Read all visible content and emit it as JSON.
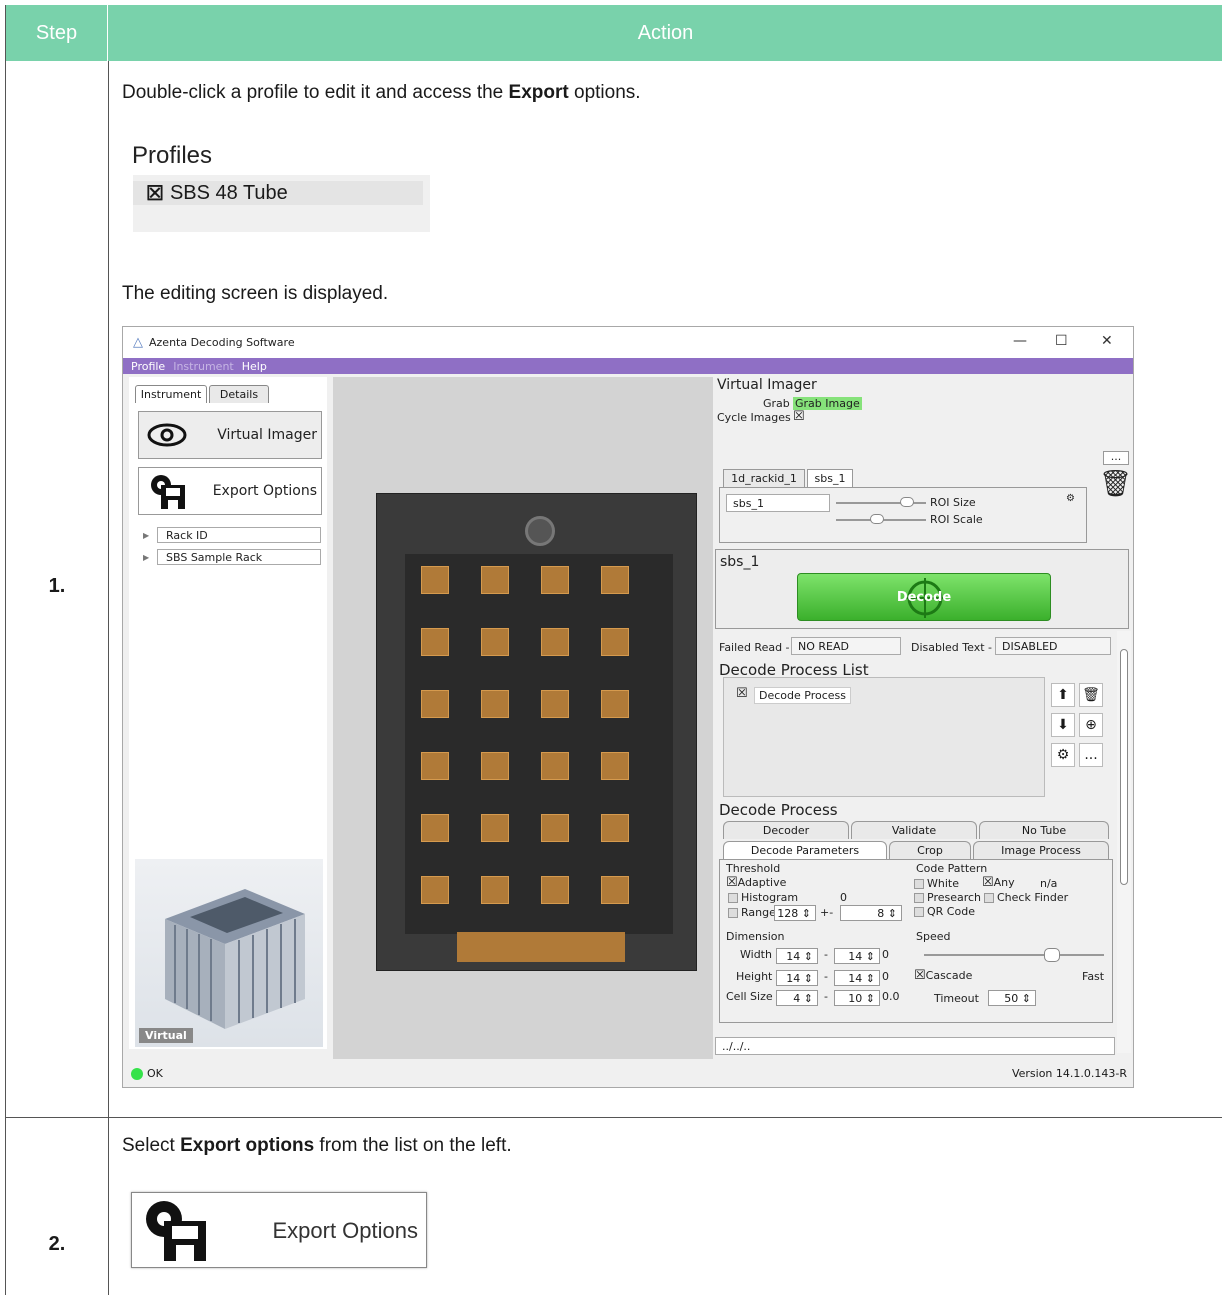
{
  "header": {
    "step": "Step",
    "action": "Action"
  },
  "steps": [
    {
      "num": "1.",
      "intro_pre": "Double-click a profile to edit it and access the ",
      "intro_bold": "Export",
      "intro_post": " options.",
      "result": "The editing screen is displayed."
    },
    {
      "num": "2.",
      "intro_pre": "Select ",
      "intro_bold": "Export options",
      "intro_post": " from the list on the left."
    }
  ],
  "profiles": {
    "title": "Profiles",
    "item": "SBS 48 Tube"
  },
  "app": {
    "window_title": "Azenta Decoding Software",
    "menu": [
      "Profile",
      "Instrument",
      "Help"
    ],
    "left_tabs": [
      "Instrument",
      "Details"
    ],
    "virtual_imager_btn": "Virtual Imager",
    "export_options_btn": "Export Options",
    "tree": [
      "Rack ID",
      "SBS Sample Rack"
    ],
    "virtual_badge": "Virtual",
    "right": {
      "title": "Virtual Imager",
      "grab_label": "Grab",
      "grab_value": "Grab Image",
      "cycle_label": "Cycle Images",
      "more": "...",
      "roi_tabs": [
        "1d_rackid_1",
        "sbs_1"
      ],
      "roi_name": "sbs_1",
      "roi_size": "ROI Size",
      "roi_scale": "ROI Scale",
      "section_name": "sbs_1",
      "decode_btn": "Decode",
      "failed_read_label": "Failed Read -",
      "failed_read_value": "NO READ",
      "disabled_text_label": "Disabled Text -",
      "disabled_text_value": "DISABLED",
      "process_list_title": "Decode Process List",
      "process_item": "Decode Process",
      "process_title": "Decode Process",
      "tabs_row1": [
        "Decoder",
        "Validate",
        "No Tube"
      ],
      "tabs_row2": [
        "Decode Parameters",
        "Crop",
        "Image Process"
      ],
      "threshold_title": "Threshold",
      "adaptive": "Adaptive",
      "histogram": "Histogram",
      "histogram_val": "0",
      "range": "Range",
      "range_val": "128",
      "range_pm": "+-",
      "range_pm_val": "8",
      "code_pattern_title": "Code Pattern",
      "white": "White",
      "any": "Any",
      "na": "n/a",
      "presearch": "Presearch",
      "check_finder": "Check Finder",
      "qr_code": "QR Code",
      "dimension_title": "Dimension",
      "width": "Width",
      "height": "Height",
      "cell_size": "Cell Size",
      "width_min": "14",
      "width_max": "14",
      "width_suffix": "0",
      "height_min": "14",
      "height_max": "14",
      "height_suffix": "0",
      "cell_min": "4",
      "cell_max": "10",
      "cell_suffix": "0.0",
      "dash": "-",
      "speed_title": "Speed",
      "cascade": "Cascade",
      "fast": "Fast",
      "timeout": "Timeout",
      "timeout_val": "50",
      "path": "../../.."
    },
    "status_ok": "OK",
    "version": "Version 14.1.0.143-R"
  },
  "export_snippet_label": "Export Options",
  "colors": {
    "header_bg": "#79d2ab",
    "menubar_bg": "#8f6fc5",
    "decode_green": "#3bb02c",
    "well_orange": "#b07a38"
  }
}
